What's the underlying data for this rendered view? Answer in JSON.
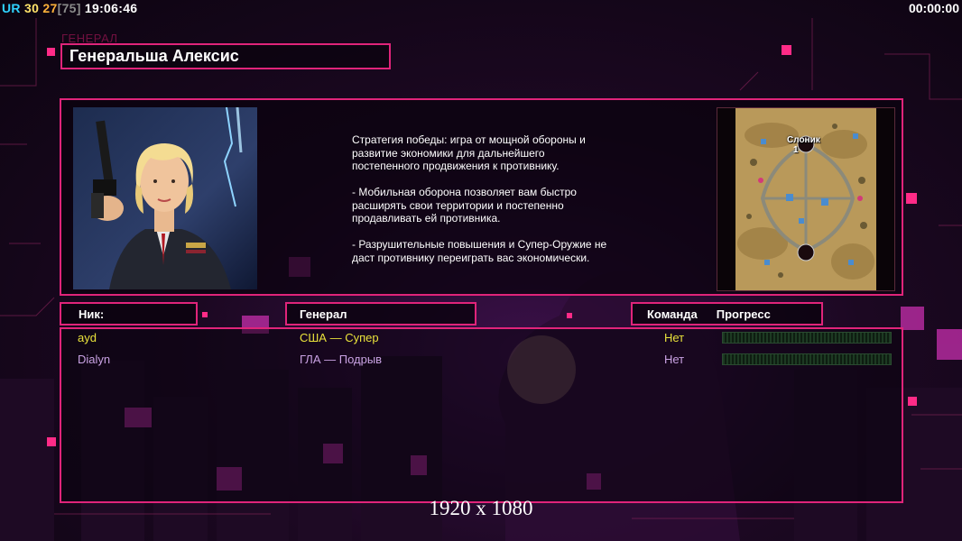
{
  "hud": {
    "tag": "UR",
    "fps": "30",
    "value_a": "27",
    "value_b": "[75]",
    "clock": "19:06:46",
    "timer": "00:00:00"
  },
  "header": {
    "ghost_label": "ГЕНЕРАЛ",
    "general_name": "Генеральша Алексис"
  },
  "info": {
    "strategy_text": "Стратегия победы: игра от мощной обороны и\n развитие экономики для дальнейшего\n постепенного продвижения к противнику.\n\n- Мобильная оборона позволяет вам быстро\n расширять свои территории и постепенно\n продавливать ей противника.\n\n- Разрушительные повышения и Супер-Оружие не\n даст противнику переиграть вас экономически.",
    "map_name": "Слоник",
    "map_player_slot": "1"
  },
  "table": {
    "headers": {
      "nick": "Ник:",
      "general": "Генерал",
      "team": "Команда",
      "progress": "Прогресс"
    },
    "rows": [
      {
        "nick": "ayd",
        "general": "США — Супер",
        "team": "Нет",
        "progress": 0,
        "color": "#e9e23b"
      },
      {
        "nick": "Dialyn",
        "general": "ГЛА — Подрыв",
        "team": "Нет",
        "progress": 0,
        "color": "#c9a2e3"
      }
    ]
  },
  "footer": {
    "resolution": "1920 x 1080"
  },
  "colors": {
    "accent": "#e0247a",
    "progress_empty": "#1d3a23",
    "progress_full": "#3fbf5a"
  }
}
